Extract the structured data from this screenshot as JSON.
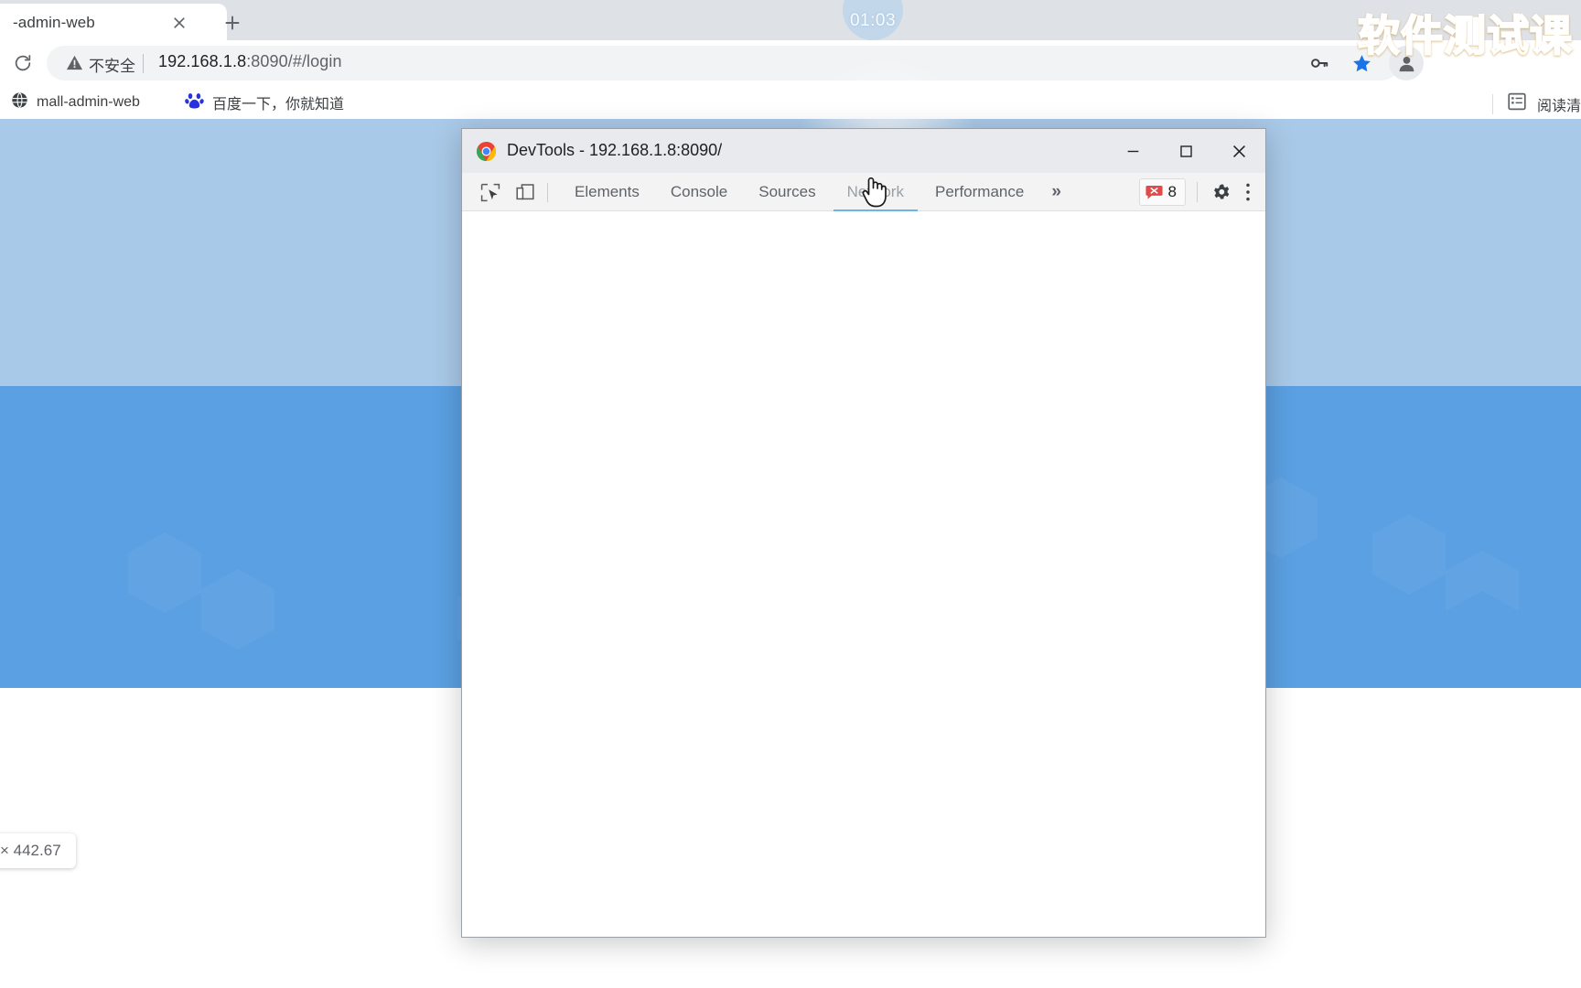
{
  "browser": {
    "tab": {
      "title": "-admin-web",
      "close_icon": "close-icon"
    },
    "new_tab_label": "+",
    "reload_icon": "reload-icon",
    "omnibox": {
      "warning_icon": "warning-triangle-icon",
      "security_label": "不安全",
      "url_host": "192.168.1.8",
      "url_rest": ":8090/#/login"
    },
    "actions": {
      "key_icon": "key-icon",
      "star_icon": "star-bookmark-icon",
      "avatar_icon": "profile-avatar-icon"
    },
    "bookmarks": [
      {
        "icon": "globe-icon",
        "label": "mall-admin-web"
      },
      {
        "icon": "baidu-paw-icon",
        "label": "百度一下，你就知道"
      }
    ],
    "reading_list": {
      "icon": "reading-list-icon",
      "label": "阅读清"
    }
  },
  "overlay": {
    "timer": "01:03",
    "watermark": "软件测试课"
  },
  "page": {
    "dimension_tooltip": "× 442.67",
    "colors": {
      "band_light": "#a9c9e8",
      "band_strong": "#5ba0e2"
    }
  },
  "devtools": {
    "title": "DevTools - 192.168.1.8:8090/",
    "logo_icon": "chrome-logo-icon",
    "window_controls": {
      "minimize": "minimize-icon",
      "maximize": "maximize-icon",
      "close": "close-icon"
    },
    "toolbar_icons": {
      "inspect": "inspect-element-icon",
      "device": "device-toolbar-icon",
      "gear": "gear-icon",
      "kebab": "kebab-menu-icon",
      "error": "error-x-icon"
    },
    "tabs": [
      {
        "label": "Elements",
        "active": false
      },
      {
        "label": "Console",
        "active": false
      },
      {
        "label": "Sources",
        "active": false
      },
      {
        "label": "Network",
        "active": true
      },
      {
        "label": "Performance",
        "active": false
      }
    ],
    "more_tabs_label": "»",
    "error_count": "8",
    "accent_color": "#6cb5e8"
  }
}
